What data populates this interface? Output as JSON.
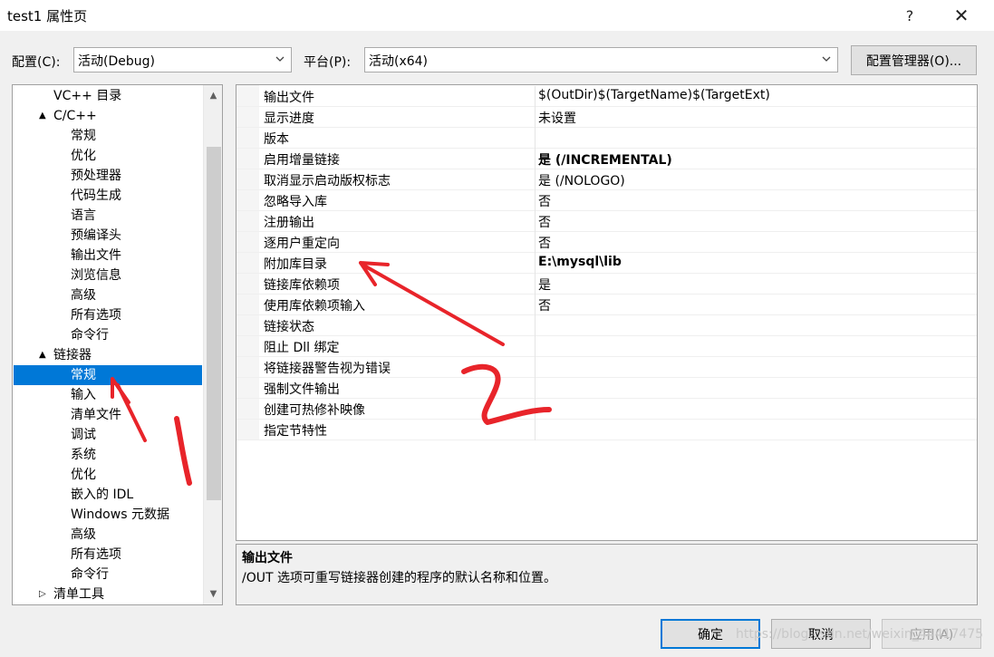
{
  "window": {
    "title": "test1 属性页",
    "help_glyph": "?",
    "close_glyph": "✕"
  },
  "config": {
    "label": "配置(C):",
    "value": "活动(Debug)"
  },
  "platform": {
    "label": "平台(P):",
    "value": "活动(x64)"
  },
  "config_manager_label": "配置管理器(O)...",
  "tree": {
    "items": [
      {
        "label": "VC++ 目录",
        "level": 1,
        "expander": ""
      },
      {
        "label": "C/C++",
        "level": 1,
        "expander": "▲"
      },
      {
        "label": "常规",
        "level": 2,
        "expander": ""
      },
      {
        "label": "优化",
        "level": 2,
        "expander": ""
      },
      {
        "label": "预处理器",
        "level": 2,
        "expander": ""
      },
      {
        "label": "代码生成",
        "level": 2,
        "expander": ""
      },
      {
        "label": "语言",
        "level": 2,
        "expander": ""
      },
      {
        "label": "预编译头",
        "level": 2,
        "expander": ""
      },
      {
        "label": "输出文件",
        "level": 2,
        "expander": ""
      },
      {
        "label": "浏览信息",
        "level": 2,
        "expander": ""
      },
      {
        "label": "高级",
        "level": 2,
        "expander": ""
      },
      {
        "label": "所有选项",
        "level": 2,
        "expander": ""
      },
      {
        "label": "命令行",
        "level": 2,
        "expander": ""
      },
      {
        "label": "链接器",
        "level": 1,
        "expander": "▲"
      },
      {
        "label": "常规",
        "level": 2,
        "expander": "",
        "selected": true
      },
      {
        "label": "输入",
        "level": 2,
        "expander": ""
      },
      {
        "label": "清单文件",
        "level": 2,
        "expander": ""
      },
      {
        "label": "调试",
        "level": 2,
        "expander": ""
      },
      {
        "label": "系统",
        "level": 2,
        "expander": ""
      },
      {
        "label": "优化",
        "level": 2,
        "expander": ""
      },
      {
        "label": "嵌入的 IDL",
        "level": 2,
        "expander": ""
      },
      {
        "label": "Windows 元数据",
        "level": 2,
        "expander": ""
      },
      {
        "label": "高级",
        "level": 2,
        "expander": ""
      },
      {
        "label": "所有选项",
        "level": 2,
        "expander": ""
      },
      {
        "label": "命令行",
        "level": 2,
        "expander": ""
      },
      {
        "label": "清单工具",
        "level": 0,
        "expander": "▷"
      }
    ]
  },
  "properties": [
    {
      "name": "输出文件",
      "value": "$(OutDir)$(TargetName)$(TargetExt)",
      "bold": false
    },
    {
      "name": "显示进度",
      "value": "未设置",
      "bold": false
    },
    {
      "name": "版本",
      "value": "",
      "bold": false
    },
    {
      "name": "启用增量链接",
      "value": "是 (/INCREMENTAL)",
      "bold": true
    },
    {
      "name": "取消显示启动版权标志",
      "value": "是 (/NOLOGO)",
      "bold": false
    },
    {
      "name": "忽略导入库",
      "value": "否",
      "bold": false
    },
    {
      "name": "注册输出",
      "value": "否",
      "bold": false
    },
    {
      "name": "逐用户重定向",
      "value": "否",
      "bold": false
    },
    {
      "name": "附加库目录",
      "value": "E:\\mysql\\lib",
      "bold": true
    },
    {
      "name": "链接库依赖项",
      "value": "是",
      "bold": false
    },
    {
      "name": "使用库依赖项输入",
      "value": "否",
      "bold": false
    },
    {
      "name": "链接状态",
      "value": "",
      "bold": false
    },
    {
      "name": "阻止 Dll 绑定",
      "value": "",
      "bold": false
    },
    {
      "name": "将链接器警告视为错误",
      "value": "",
      "bold": false
    },
    {
      "name": "强制文件输出",
      "value": "",
      "bold": false
    },
    {
      "name": "创建可热修补映像",
      "value": "",
      "bold": false
    },
    {
      "name": "指定节特性",
      "value": "",
      "bold": false
    }
  ],
  "description": {
    "title": "输出文件",
    "text": "/OUT 选项可重写链接器创建的程序的默认名称和位置。"
  },
  "buttons": {
    "ok": "确定",
    "cancel": "取消",
    "apply": "应用(A)"
  },
  "watermark": "https://blog.csdn.net/weixin_44417475",
  "annotation_color": "#e8242a"
}
